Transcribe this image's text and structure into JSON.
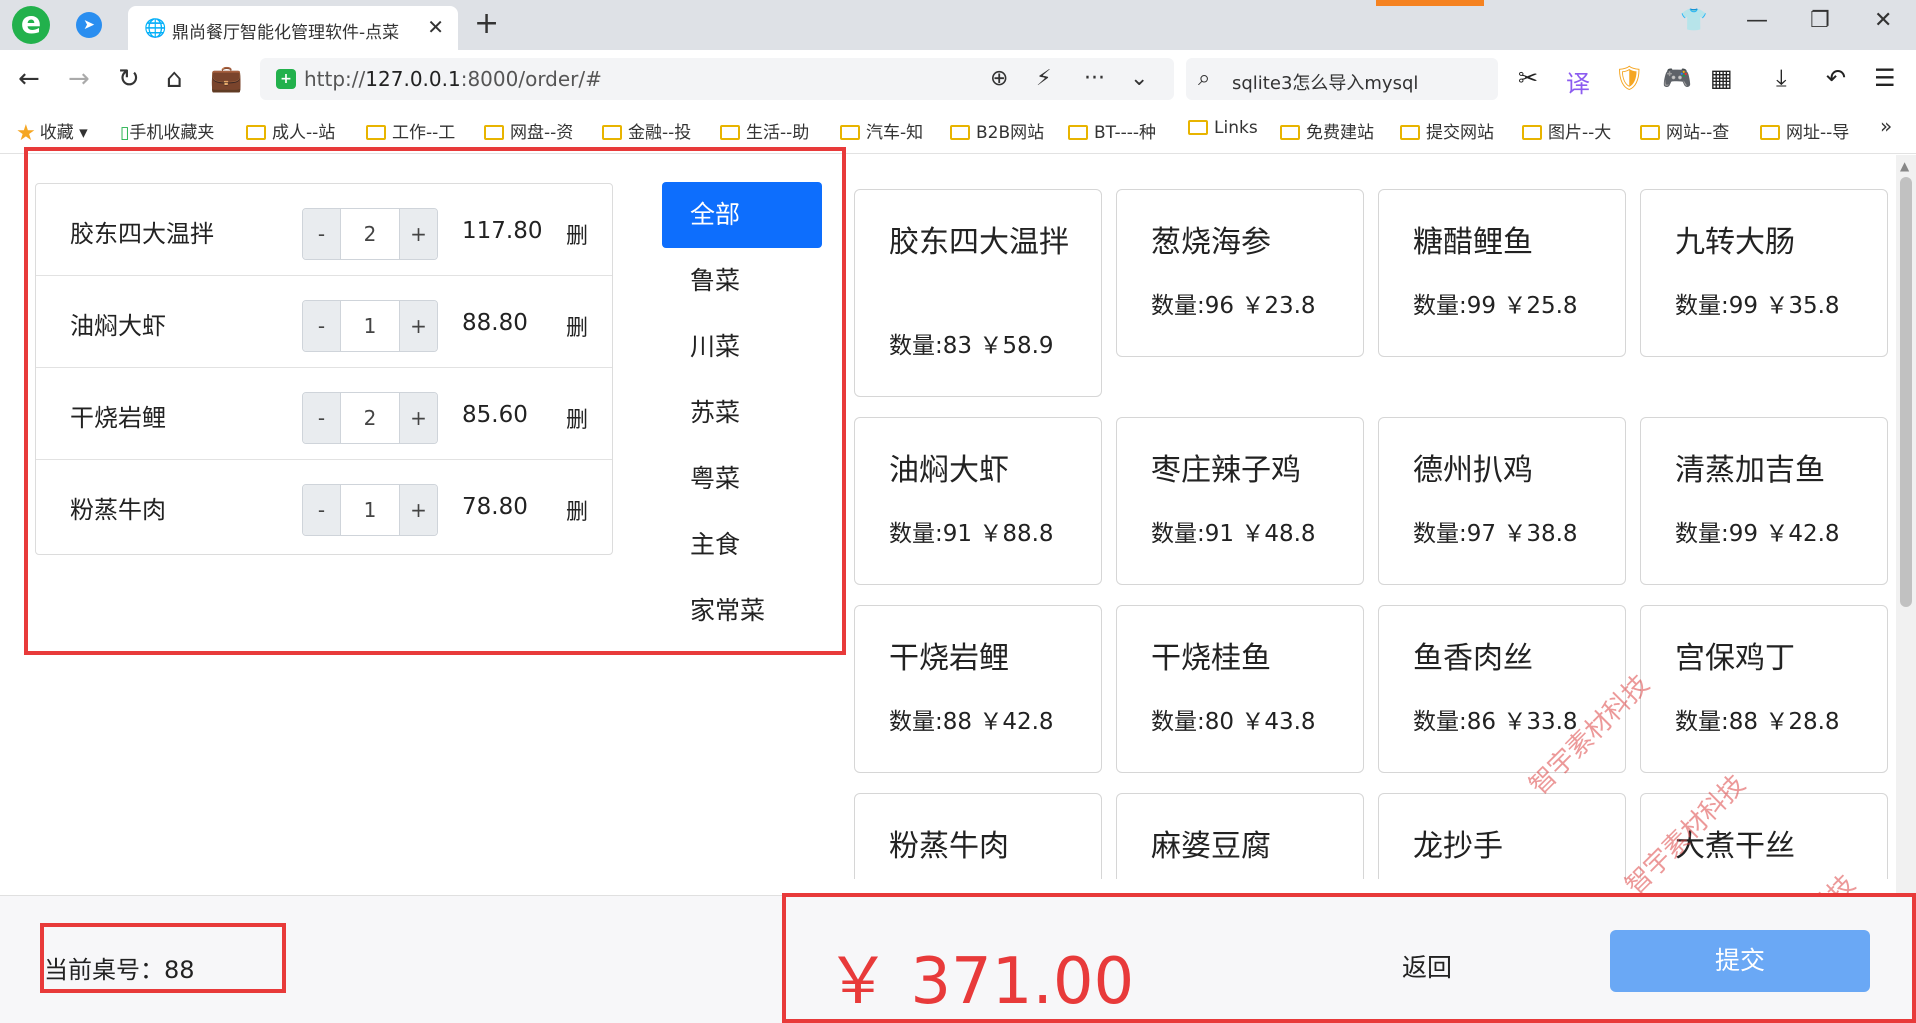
{
  "browser": {
    "tab_title": "鼎尚餐厅智能化管理软件-点菜",
    "url_prefix": "http://",
    "url_host": "127.0.0.1",
    "url_rest": ":8000/order/#",
    "search_text": "sqlite3怎么导入mysql",
    "bookmarks": [
      "收藏",
      "手机收藏夹",
      "成人--站",
      "工作--工",
      "网盘--资",
      "金融--投",
      "生活--助",
      "汽车-知",
      "B2B网站",
      "BT----种",
      "Links",
      "免费建站",
      "提交网站",
      "图片--大",
      "网站--查",
      "网址--导"
    ]
  },
  "order": {
    "items": [
      {
        "name": "胶东四大温拌",
        "qty": "2",
        "price": "117.80",
        "minus": "-",
        "plus": "+",
        "delete": "删"
      },
      {
        "name": "油焖大虾",
        "qty": "1",
        "price": "88.80",
        "minus": "-",
        "plus": "+",
        "delete": "删"
      },
      {
        "name": "干烧岩鲤",
        "qty": "2",
        "price": "85.60",
        "minus": "-",
        "plus": "+",
        "delete": "删"
      },
      {
        "name": "粉蒸牛肉",
        "qty": "1",
        "price": "78.80",
        "minus": "-",
        "plus": "+",
        "delete": "删"
      }
    ]
  },
  "categories": [
    "全部",
    "鲁菜",
    "川菜",
    "苏菜",
    "粤菜",
    "主食",
    "家常菜"
  ],
  "dishes": [
    {
      "name": "胶东四大温拌",
      "info": "数量:83 ￥58.9"
    },
    {
      "name": "葱烧海参",
      "info": "数量:96 ￥23.8"
    },
    {
      "name": "糖醋鲤鱼",
      "info": "数量:99 ￥25.8"
    },
    {
      "name": "九转大肠",
      "info": "数量:99 ￥35.8"
    },
    {
      "name": "油焖大虾",
      "info": "数量:91 ￥88.8"
    },
    {
      "name": "枣庄辣子鸡",
      "info": "数量:91 ￥48.8"
    },
    {
      "name": "德州扒鸡",
      "info": "数量:97 ￥38.8"
    },
    {
      "name": "清蒸加吉鱼",
      "info": "数量:99 ￥42.8"
    },
    {
      "name": "干烧岩鲤",
      "info": "数量:88 ￥42.8"
    },
    {
      "name": "干烧桂鱼",
      "info": "数量:80 ￥43.8"
    },
    {
      "name": "鱼香肉丝",
      "info": "数量:86 ￥33.8"
    },
    {
      "name": "宫保鸡丁",
      "info": "数量:88 ￥28.8"
    },
    {
      "name": "粉蒸牛肉",
      "info": ""
    },
    {
      "name": "麻婆豆腐",
      "info": ""
    },
    {
      "name": "龙抄手",
      "info": ""
    },
    {
      "name": "大煮干丝",
      "info": ""
    }
  ],
  "watermark": "智宇素材科技",
  "footer": {
    "table_label": "当前桌号：88",
    "total": "￥ 371.00",
    "back_label": "返回",
    "submit_label": "提交"
  },
  "colors": {
    "primary": "#0d6efd",
    "submit": "#6aa8f5",
    "total_red": "#e83a3a",
    "annotation_red": "#e83a3a"
  }
}
